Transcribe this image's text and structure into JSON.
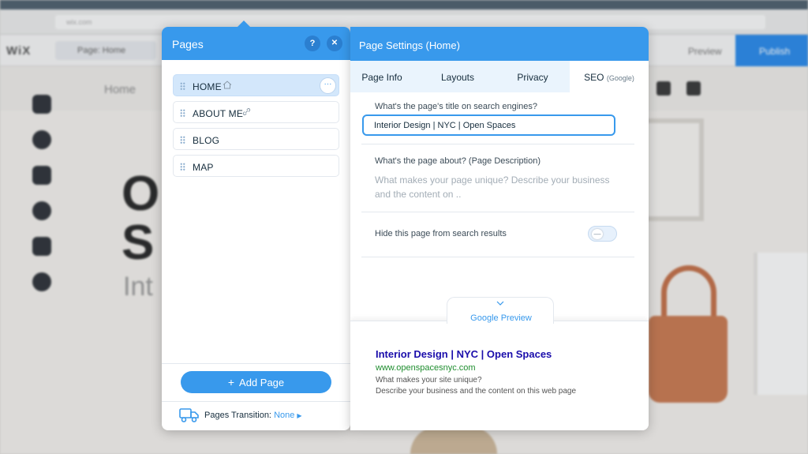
{
  "background": {
    "url": "wix.com",
    "logo": "WiX",
    "page_selector": "Page: Home",
    "preview": "Preview",
    "publish": "Publish",
    "menu_item": "Home",
    "hero_line1": "O",
    "hero_line2": "S",
    "hero_sub": "Int"
  },
  "pages_panel": {
    "title": "Pages",
    "help_label": "?",
    "close_label": "✕",
    "items": [
      {
        "label": "HOME",
        "icon": "home-icon",
        "selected": true
      },
      {
        "label": "ABOUT ME",
        "icon": "link-icon",
        "selected": false
      },
      {
        "label": "BLOG",
        "icon": "",
        "selected": false
      },
      {
        "label": "MAP",
        "icon": "",
        "selected": false
      }
    ],
    "more_label": "···",
    "add_page_label": "Add Page",
    "transition_label": "Pages Transition:",
    "transition_value": "None"
  },
  "settings_panel": {
    "title": "Page Settings (Home)",
    "tabs": [
      {
        "label": "Page Info",
        "active": false
      },
      {
        "label": "Layouts",
        "active": false
      },
      {
        "label": "Privacy",
        "active": false
      },
      {
        "label": "SEO",
        "sub": "(Google)",
        "active": true
      }
    ],
    "seo": {
      "title_question": "What's the page's title on search engines?",
      "title_value": "Interior Design | NYC | Open Spaces",
      "description_question": "What's the page about? (Page Description)",
      "description_placeholder": "What makes your page unique? Describe your business and the content on ..",
      "hide_label": "Hide this page from search results",
      "hide_enabled": false
    },
    "google_preview": {
      "label": "Google Preview",
      "title": "Interior Design | NYC | Open Spaces",
      "url": "www.openspacesnyc.com",
      "desc_line1": "What makes your site unique?",
      "desc_line2": "Describe your business and the content on this web page"
    }
  },
  "colors": {
    "accent": "#3899ec",
    "selected_item": "#d3e7fb",
    "serp_title": "#1a0dab",
    "serp_url": "#1e8d2e"
  }
}
